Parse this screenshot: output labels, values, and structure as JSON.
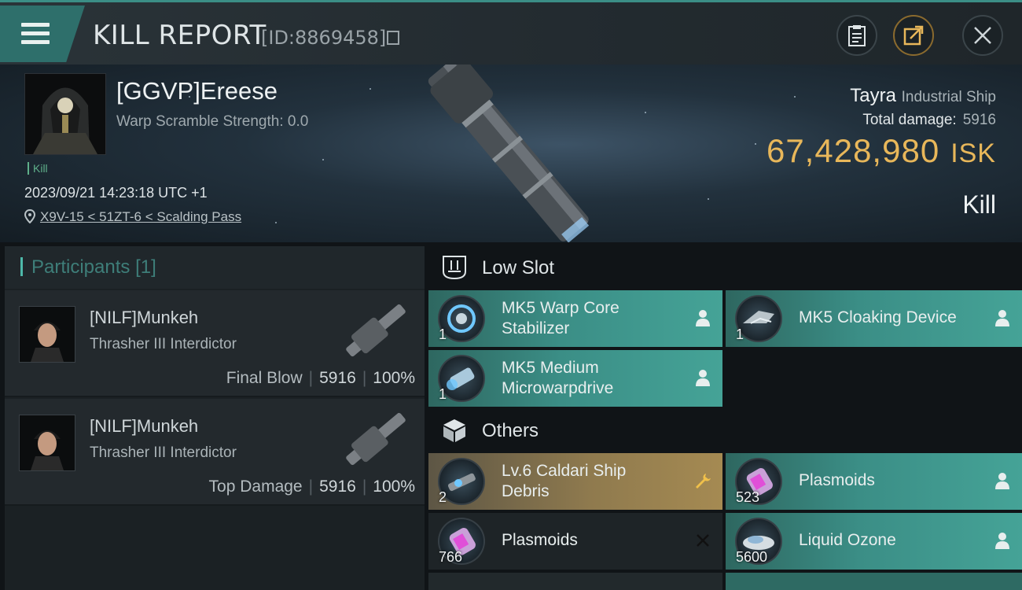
{
  "header": {
    "title": "KILL REPORT",
    "report_id": "[ID:8869458]"
  },
  "victim": {
    "name": "[GGVP]Ereese",
    "warp_scramble": "Warp Scramble Strength: 0.0",
    "tag": "Kill",
    "datetime": "2023/09/21 14:23:18 UTC +1",
    "location": "X9V-15 < 51ZT-6 < Scalding Pass",
    "ship_name": "Tayra",
    "ship_class": "Industrial Ship",
    "total_damage_label": "Total damage:",
    "total_damage": "5916",
    "isk_value": "67,428,980",
    "isk_unit": "ISK",
    "result": "Kill"
  },
  "participants": {
    "label": "Participants",
    "count": "[1]",
    "rows": [
      {
        "name": "[NILF]Munkeh",
        "ship": "Thrasher III Interdictor",
        "role": "Final Blow",
        "damage": "5916",
        "percent": "100%"
      },
      {
        "name": "[NILF]Munkeh",
        "ship": "Thrasher III Interdictor",
        "role": "Top Damage",
        "damage": "5916",
        "percent": "100%"
      }
    ]
  },
  "sections": {
    "low_slot": "Low Slot",
    "others": "Others"
  },
  "low_slot_items": [
    {
      "line1": "MK5 Warp Core",
      "line2": "Stabilizer",
      "qty": "1",
      "state": "dropped"
    },
    {
      "line1": "MK5 Cloaking Device",
      "line2": "",
      "qty": "1",
      "state": "dropped"
    },
    {
      "line1": "MK5 Medium",
      "line2": "Microwarpdrive",
      "qty": "1",
      "state": "dropped"
    }
  ],
  "other_items": [
    {
      "line1": "Lv.6 Caldari Ship",
      "line2": "Debris",
      "qty": "2",
      "state": "salvage"
    },
    {
      "line1": "Plasmoids",
      "line2": "",
      "qty": "523",
      "state": "dropped"
    },
    {
      "line1": "Plasmoids",
      "line2": "",
      "qty": "766",
      "state": "destroyed"
    },
    {
      "line1": "Liquid Ozone",
      "line2": "",
      "qty": "5600",
      "state": "dropped"
    }
  ],
  "colors": {
    "accent_teal": "#3b8e86",
    "isk_gold": "#e8b75a",
    "salvage_gold": "#a58a52"
  },
  "icons": {
    "menu": "hamburger-icon",
    "copy": "copy-icon",
    "clipboard": "clipboard-icon",
    "share": "share-icon",
    "close": "close-icon",
    "location": "location-pin-icon",
    "low_slot": "low-slot-icon",
    "others": "cube-icon",
    "dropped": "person-icon",
    "salvage": "wrench-icon",
    "destroyed": "x-icon"
  }
}
